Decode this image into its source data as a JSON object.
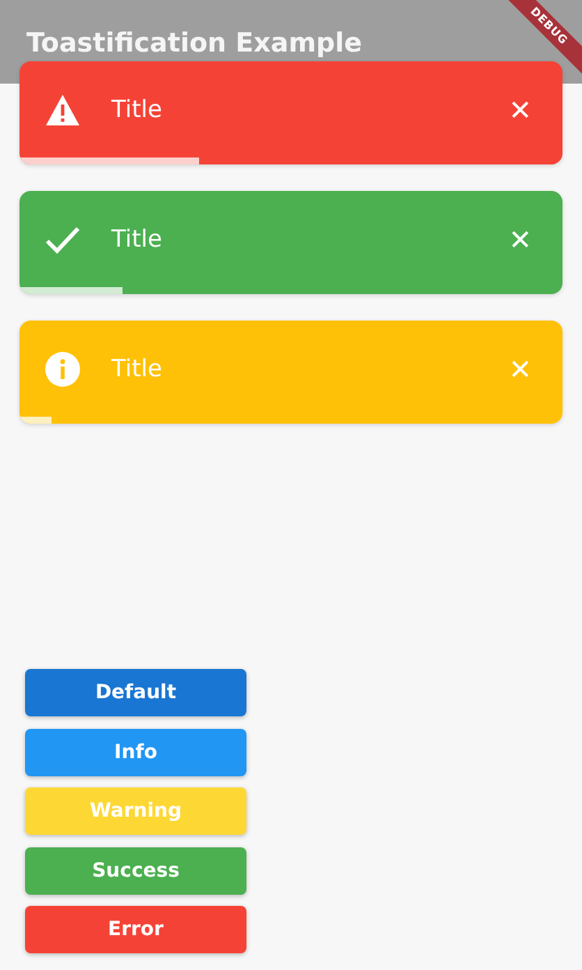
{
  "app_bar": {
    "title": "Toastification Example"
  },
  "debug_banner": {
    "label": "DEBUG"
  },
  "toasts": [
    {
      "kind": "error",
      "title": "Title",
      "close": "✕",
      "level": 0.33
    },
    {
      "kind": "success",
      "title": "Title",
      "close": "✕",
      "level": 0.19
    },
    {
      "kind": "warning",
      "title": "Title",
      "close": "✕",
      "level": 0.06
    }
  ],
  "buttons": [
    {
      "label": "Default",
      "color": "#1976d2"
    },
    {
      "label": "Info",
      "color": "#2196f3"
    },
    {
      "label": "Warning",
      "color": "#fdd835"
    },
    {
      "label": "Success",
      "color": "#4caf50"
    },
    {
      "label": "Error",
      "color": "#f44336"
    }
  ]
}
